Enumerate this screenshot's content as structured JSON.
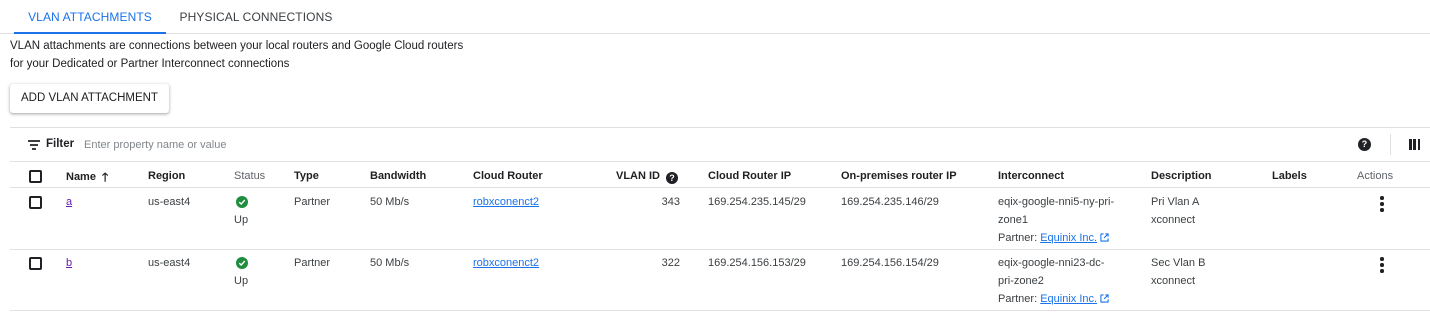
{
  "tabs": [
    {
      "label": "VLAN ATTACHMENTS",
      "active": true
    },
    {
      "label": "PHYSICAL CONNECTIONS",
      "active": false
    }
  ],
  "intro": {
    "line1": "VLAN attachments are connections between your local routers and Google Cloud routers",
    "line2": "for your Dedicated or Partner Interconnect connections"
  },
  "add_button": "ADD VLAN ATTACHMENT",
  "filter": {
    "label": "Filter",
    "placeholder": "Enter property name or value",
    "filter_icon": "filter-list-icon",
    "help_icon": "help-icon",
    "columns_icon": "column-display-icon"
  },
  "columns": {
    "name": "Name",
    "region": "Region",
    "status": "Status",
    "type": "Type",
    "bandwidth": "Bandwidth",
    "cloud_router": "Cloud Router",
    "vlan_id": "VLAN ID",
    "cloud_router_ip": "Cloud Router IP",
    "onprem_ip": "On-premises router IP",
    "interconnect": "Interconnect",
    "description": "Description",
    "labels": "Labels",
    "actions": "Actions"
  },
  "rows": [
    {
      "name": "a",
      "region": "us-east4",
      "status": "Up",
      "type": "Partner",
      "bandwidth": "50 Mb/s",
      "cloud_router": "robxconenct2",
      "vlan_id": "343",
      "cloud_router_ip": "169.254.235.145/29",
      "onprem_ip": "169.254.235.146/29",
      "interconnect_line1": "eqix-google-nni5-ny-pri-",
      "interconnect_line2": "zone1",
      "partner_label": "Partner:",
      "partner_name": "Equinix Inc.",
      "description_line1": "Pri Vlan A",
      "description_line2": "xconnect",
      "labels": ""
    },
    {
      "name": "b",
      "region": "us-east4",
      "status": "Up",
      "type": "Partner",
      "bandwidth": "50 Mb/s",
      "cloud_router": "robxconenct2",
      "vlan_id": "322",
      "cloud_router_ip": "169.254.156.153/29",
      "onprem_ip": "169.254.156.154/29",
      "interconnect_line1": "eqix-google-nni23-dc-",
      "interconnect_line2": "pri-zone2",
      "partner_label": "Partner:",
      "partner_name": "Equinix Inc.",
      "description_line1": "Sec Vlan B",
      "description_line2": "xconnect",
      "labels": ""
    }
  ],
  "colors": {
    "accent": "#1a73e8",
    "status_ok": "#1e8e3e",
    "visited_link": "#681da8"
  }
}
